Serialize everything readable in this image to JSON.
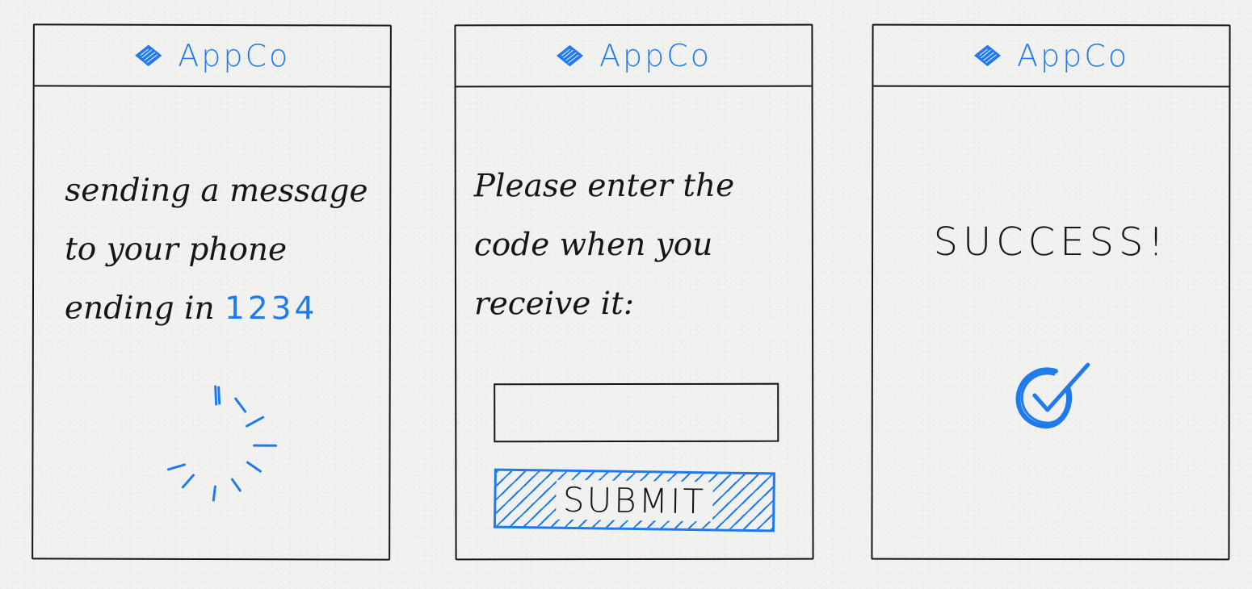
{
  "brand": {
    "name": "AppCo",
    "accent_color": "#1f7aee",
    "logo_icon": "diamond-icon"
  },
  "screens": [
    {
      "message_lines": [
        "sending a message",
        "to your phone",
        "ending in "
      ],
      "phone_suffix": "1234",
      "status_icon": "loading-spinner-icon"
    },
    {
      "message": "Please enter the\ncode when you\nreceive it:",
      "code_input": {
        "value": "",
        "placeholder": ""
      },
      "submit_label": "SUBMIT"
    },
    {
      "message": "SUCCESS!",
      "status_icon": "checkmark-circle-icon"
    }
  ]
}
